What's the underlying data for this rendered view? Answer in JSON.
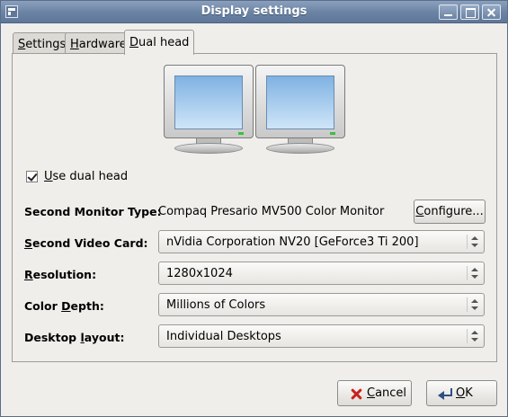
{
  "window": {
    "title": "Display settings"
  },
  "tabs": [
    {
      "label": "Settings",
      "u": "S",
      "rest": "ettings"
    },
    {
      "label": "Hardware",
      "u": "H",
      "rest": "ardware"
    },
    {
      "label": "Dual head",
      "u": "D",
      "rest": "ual head",
      "active": true
    }
  ],
  "dual_head": {
    "use_dual_head": {
      "label": "Use dual head",
      "u": "U",
      "rest": "se dual head",
      "checked": true
    },
    "second_monitor_type": {
      "label": "Second Monitor Type:",
      "value": "Compaq Presario MV500 Color Monitor",
      "configure": "Configure...",
      "configure_u": "C",
      "configure_rest": "onfigure..."
    },
    "second_video_card": {
      "label": "Second Video Card:",
      "u": "S",
      "rest": "econd Video Card:",
      "value": "nVidia Corporation NV20 [GeForce3 Ti 200]"
    },
    "resolution": {
      "label": "Resolution:",
      "u": "R",
      "rest": "esolution:",
      "value": "1280x1024"
    },
    "color_depth": {
      "label": "Color Depth:",
      "pre": "Color ",
      "u": "D",
      "rest": "epth:",
      "value": "Millions of Colors"
    },
    "desktop_layout": {
      "label": "Desktop layout:",
      "pre": "Desktop ",
      "u": "l",
      "rest": "ayout:",
      "value": "Individual Desktops"
    }
  },
  "buttons": {
    "cancel": {
      "label": "Cancel",
      "u": "C",
      "rest": "ancel",
      "icon": "cancel-icon"
    },
    "ok": {
      "label": "OK",
      "u": "O",
      "rest": "K",
      "icon": "ok-icon"
    }
  },
  "colors": {
    "titlebar": "#6a82a3",
    "screen": "#9fc8ee",
    "led": "#3cc03c",
    "cancel_icon": "#c8231d"
  }
}
